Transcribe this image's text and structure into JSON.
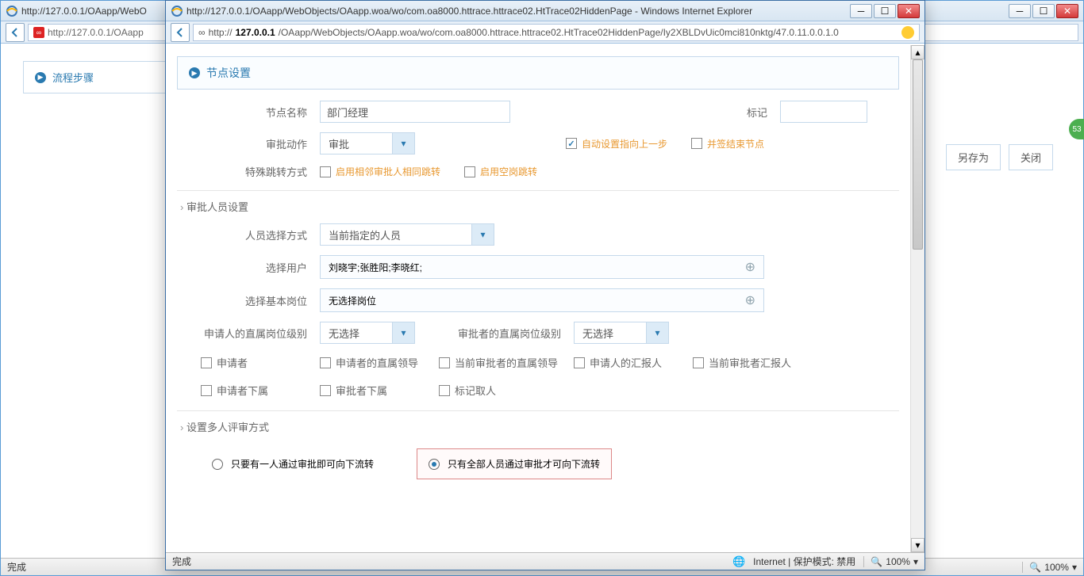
{
  "bgWin": {
    "title": "http://127.0.0.1/OAapp/WebO",
    "url": "http://127.0.0.1/OAapp",
    "leftHeader": "流程步骤",
    "btnSaveAs": "另存为",
    "btnClose": "关闭",
    "statusDone": "完成",
    "zoom": "100%"
  },
  "fgWin": {
    "title": "http://127.0.0.1/OAapp/WebObjects/OAapp.woa/wo/com.oa8000.httrace.httrace02.HtTrace02HiddenPage - Windows Internet Explorer",
    "urlHost": "127.0.0.1",
    "urlPath": "/OAapp/WebObjects/OAapp.woa/wo/com.oa8000.httrace.httrace02.HtTrace02HiddenPage/Iy2XBLDvUic0mci810nktg/47.0.11.0.0.1.0",
    "statusDone": "完成",
    "statusNet": "Internet | 保护模式: 禁用",
    "zoom": "100%"
  },
  "panel": {
    "header": "节点设置",
    "nodeNameLbl": "节点名称",
    "nodeNameVal": "部门经理",
    "markLbl": "标记",
    "markVal": "",
    "approvalActionLbl": "审批动作",
    "approvalActionVal": "审批",
    "autoPrevLbl": "自动设置指向上一步",
    "coSignLbl": "并签结束节点",
    "specialJumpLbl": "特殊跳转方式",
    "enableNeighborLbl": "启用相邻审批人相同跳转",
    "enableEmptyLbl": "启用空岗跳转"
  },
  "section2": {
    "header": "审批人员设置",
    "selectModeLbl": "人员选择方式",
    "selectModeVal": "当前指定的人员",
    "selectUserLbl": "选择用户",
    "selectUserVal": "刘晓宇;张胜阳;李晓红;",
    "selectPostLbl": "选择基本岗位",
    "selectPostVal": "无选择岗位",
    "applicantLevelLbl": "申请人的直属岗位级别",
    "applicantLevelVal": "无选择",
    "approverLevelLbl": "审批者的直属岗位级别",
    "approverLevelVal": "无选择",
    "checks": [
      "申请者",
      "申请者的直属领导",
      "当前审批者的直属领导",
      "申请人的汇报人",
      "当前审批者汇报人",
      "申请者下属",
      "审批者下属",
      "标记取人"
    ]
  },
  "section3": {
    "header": "设置多人评审方式",
    "opt1": "只要有一人通过审批即可向下流转",
    "opt2": "只有全部人员通过审批才可向下流转"
  },
  "badge": "53"
}
